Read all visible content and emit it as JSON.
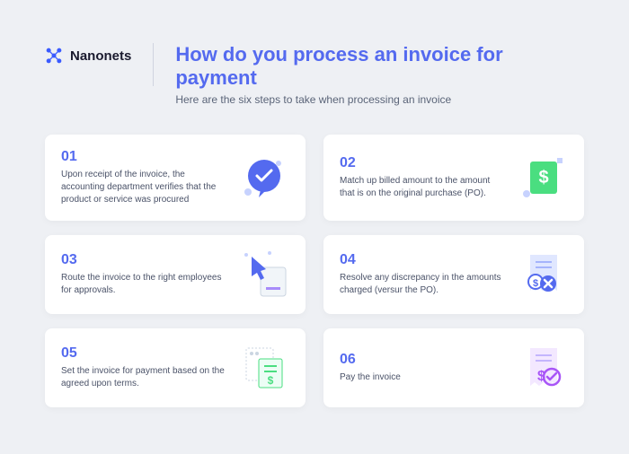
{
  "brand": {
    "name": "Nanonets"
  },
  "header": {
    "title": "How do you process an invoice for payment",
    "subtitle": "Here are the six steps to take when processing an invoice"
  },
  "steps": [
    {
      "num": "01",
      "text": "Upon receipt of the invoice, the accounting department verifies that the product or service was procured"
    },
    {
      "num": "02",
      "text": "Match up billed amount to the amount that is on the original purchase (PO)."
    },
    {
      "num": "03",
      "text": "Route the invoice to the right employees for approvals."
    },
    {
      "num": "04",
      "text": "Resolve any discrepancy in the amounts charged (versur the PO)."
    },
    {
      "num": "05",
      "text": "Set the invoice for payment based on the agreed upon terms."
    },
    {
      "num": "06",
      "text": "Pay the invoice"
    }
  ]
}
